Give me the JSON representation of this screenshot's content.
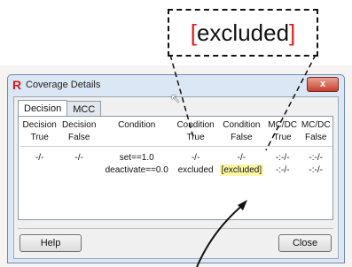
{
  "callout": {
    "open": "[",
    "word": "excluded",
    "close": "]"
  },
  "window": {
    "title": "Coverage Details",
    "app_icon": "R",
    "close_glyph": "x"
  },
  "tabs": [
    {
      "label": "Decision"
    },
    {
      "label": "MCC"
    }
  ],
  "table": {
    "headers_row1": [
      "Decision",
      "Decision",
      "Condition",
      "Condition",
      "Condition",
      "MC/DC",
      "MC/DC"
    ],
    "headers_row2": [
      "True",
      "False",
      "",
      "True",
      "False",
      "True",
      "False"
    ],
    "rows": [
      [
        "-/-",
        "-/-",
        "set==1.0",
        "-/-",
        "-/-",
        "-:-/-",
        "-:-/-"
      ],
      [
        "",
        "",
        "deactivate==0.0",
        "excluded",
        "[excluded]",
        "-:-/-",
        "-:-/-"
      ]
    ]
  },
  "buttons": {
    "help": "Help",
    "close": "Close"
  },
  "colors": {
    "accent_red": "#e21b1b",
    "highlight": "#fbf7a6",
    "window_frame": "#dbe7f4"
  },
  "icons": {
    "title_icon": "r-logo-icon",
    "cursor": "mouse-pointer-icon"
  }
}
